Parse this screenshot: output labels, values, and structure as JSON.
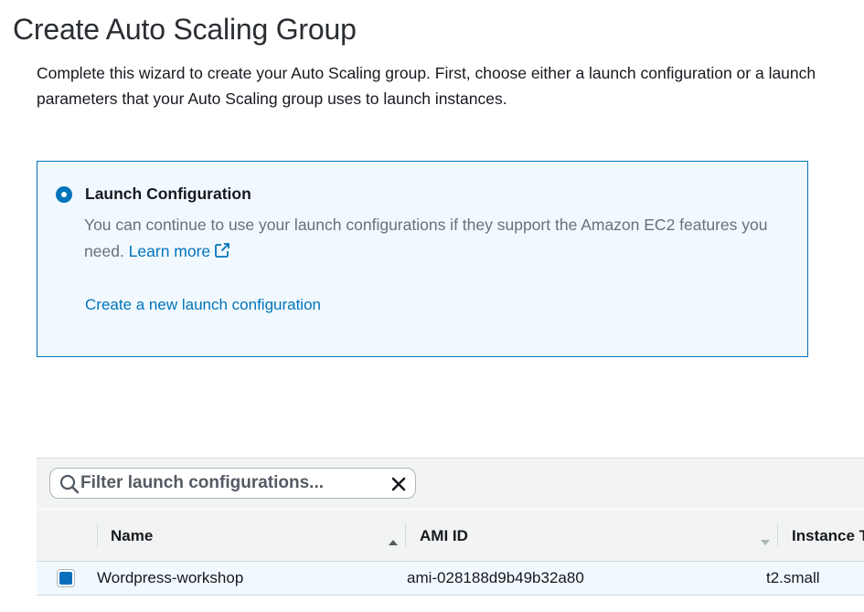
{
  "page": {
    "title": "Create Auto Scaling Group",
    "intro_line1": "Complete this wizard to create your Auto Scaling group. First, choose either a launch configuration or a launch",
    "intro_line2": "parameters that your Auto Scaling group uses to launch instances."
  },
  "launch_option": {
    "label": "Launch Configuration",
    "selected": true,
    "description": "You can continue to use your launch configurations if they support the Amazon EC2 features you need.",
    "learn_more": "Learn more",
    "create_link": "Create a new launch configuration"
  },
  "table": {
    "filter_placeholder": "Filter launch configurations...",
    "filter_value": "",
    "columns": [
      "Name",
      "AMI ID",
      "Instance Type"
    ],
    "sorted_column": "Name",
    "rows": [
      {
        "name": "Wordpress-workshop",
        "ami_id": "ami-028188d9b49b32a80",
        "instance_type": "t2.small",
        "selected": true
      }
    ]
  },
  "icons": {
    "radio": "radio-selected-icon",
    "external": "external-link-icon",
    "search": "search-icon",
    "clear": "close-icon",
    "sort_asc": "sort-ascending-icon",
    "sort_none": "sort-descending-inactive-icon"
  },
  "colors": {
    "accent": "#0073bb",
    "panel_bg": "#f1f9ff",
    "muted_text": "#687078",
    "table_header_bg": "#f2f3f3"
  }
}
